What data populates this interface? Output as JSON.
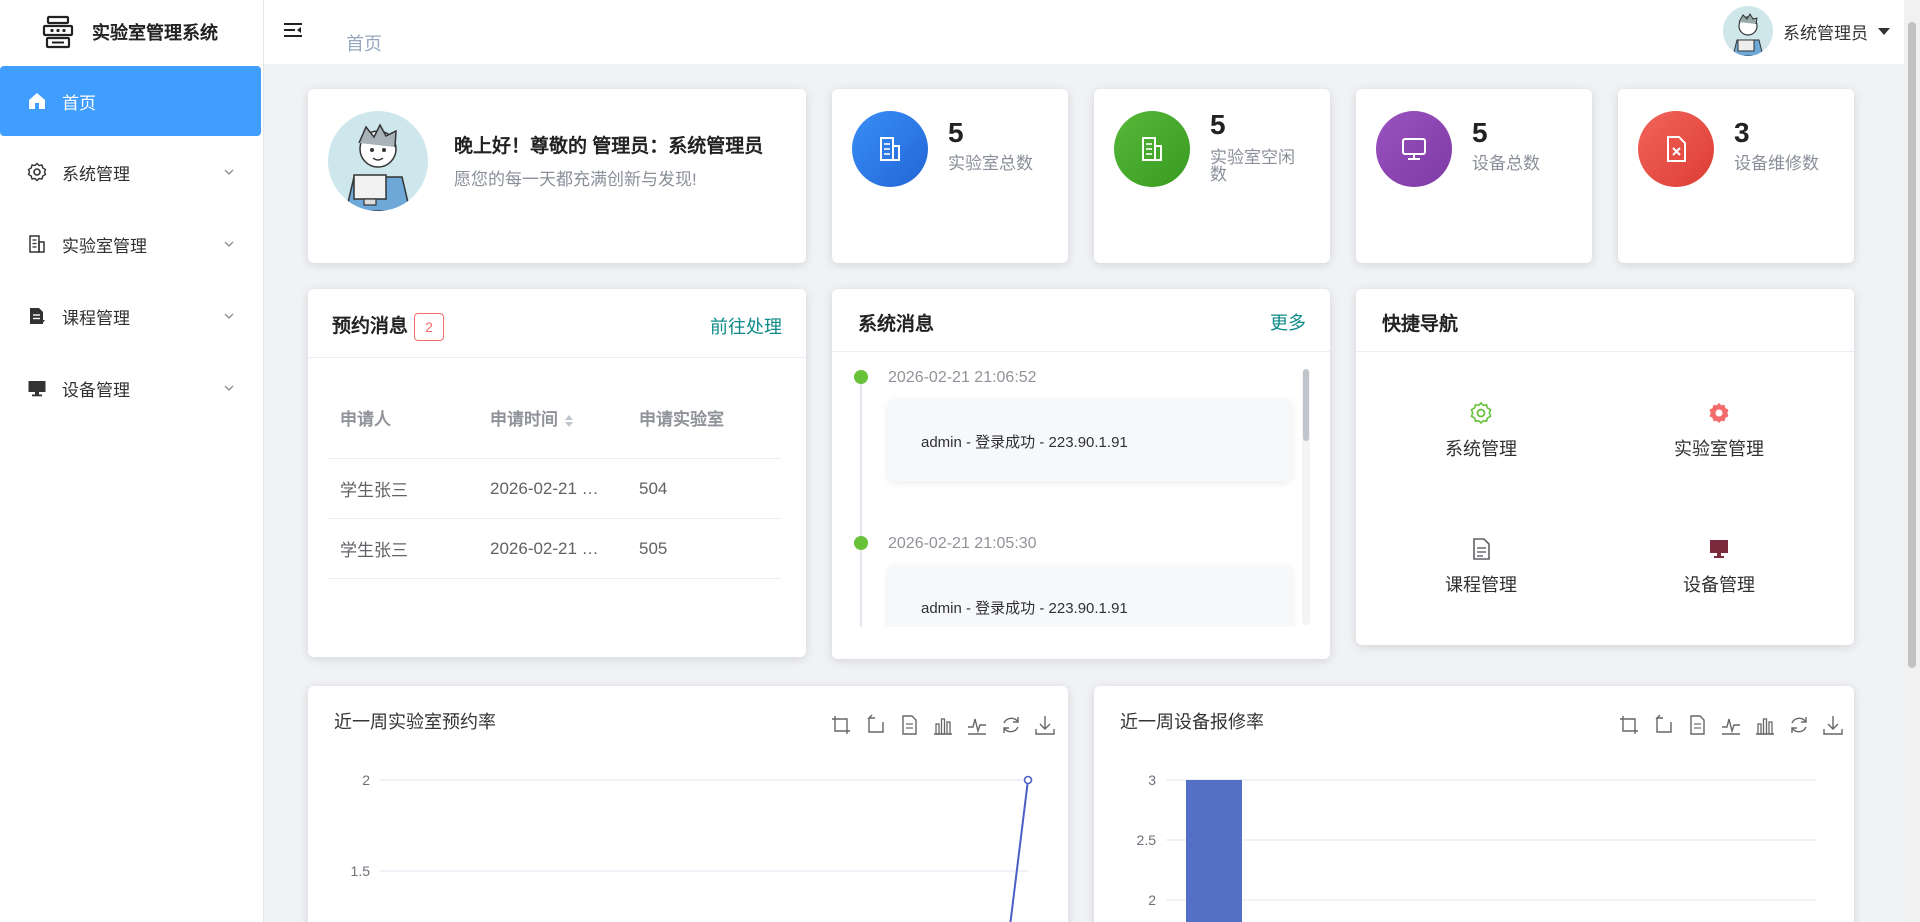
{
  "app": {
    "title": "实验室管理系统"
  },
  "sidebar": {
    "items": [
      {
        "label": "首页",
        "icon": "home-icon",
        "active": true
      },
      {
        "label": "系统管理",
        "icon": "gear-icon"
      },
      {
        "label": "实验室管理",
        "icon": "building-icon"
      },
      {
        "label": "课程管理",
        "icon": "course-icon"
      },
      {
        "label": "设备管理",
        "icon": "monitor-icon"
      }
    ]
  },
  "header": {
    "breadcrumb": "首页",
    "user_name": "系统管理员"
  },
  "welcome": {
    "greeting": "晚上好！尊敬的 管理员：系统管理员",
    "subtitle": "愿您的每一天都充满创新与发现!"
  },
  "stats": [
    {
      "value": "5",
      "label": "实验室总数",
      "color": "#2f80ed"
    },
    {
      "value": "5",
      "label": "实验室空闲数",
      "color": "#45a629"
    },
    {
      "value": "5",
      "label": "设备总数",
      "color": "#8e44ad"
    },
    {
      "value": "3",
      "label": "设备维修数",
      "color": "#e74c3c"
    }
  ],
  "reservations": {
    "title": "预约消息",
    "badge": "2",
    "link": "前往处理",
    "columns": [
      "申请人",
      "申请时间",
      "申请实验室"
    ],
    "rows": [
      [
        "学生张三",
        "2026-02-21 …",
        "504"
      ],
      [
        "学生张三",
        "2026-02-21 …",
        "505"
      ]
    ]
  },
  "system_messages": {
    "title": "系统消息",
    "link": "更多",
    "items": [
      {
        "time": "2026-02-21 21:06:52",
        "text": "admin - 登录成功 - 223.90.1.91"
      },
      {
        "time": "2026-02-21 21:05:30",
        "text": "admin - 登录成功 - 223.90.1.91"
      }
    ]
  },
  "quick_nav": {
    "title": "快捷导航",
    "items": [
      {
        "label": "系统管理",
        "icon": "gear-icon",
        "color": "#67c23a"
      },
      {
        "label": "实验室管理",
        "icon": "gear-icon",
        "color": "#f56c6c"
      },
      {
        "label": "课程管理",
        "icon": "document-icon",
        "color": "#606266"
      },
      {
        "label": "设备管理",
        "icon": "monitor-icon",
        "color": "#7a2a3a"
      }
    ]
  },
  "chart_data": [
    {
      "type": "line",
      "title": "近一周实验室预约率",
      "y_ticks": [
        "2",
        "1.5"
      ],
      "ylim_visible": [
        1.5,
        2
      ],
      "series": [
        {
          "values_visible_end": 2
        }
      ],
      "color": "#4b5fc4"
    },
    {
      "type": "bar",
      "title": "近一周设备报修率",
      "y_ticks": [
        "3",
        "2.5",
        "2"
      ],
      "ylim_visible": [
        2,
        3
      ],
      "series": [
        {
          "values_visible": [
            3
          ]
        }
      ],
      "color": "#5470c6"
    }
  ]
}
